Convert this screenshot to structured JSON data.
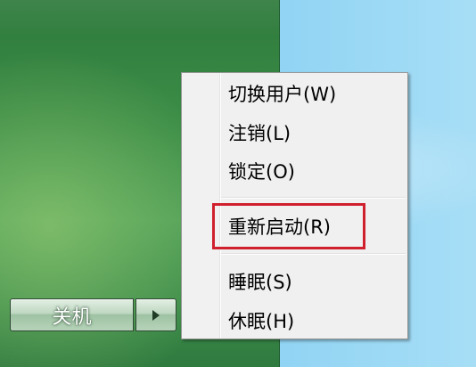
{
  "start_menu": {
    "shutdown_label": "关机",
    "arrow_icon": "triangle-right-icon"
  },
  "context_menu": {
    "items": [
      {
        "label": "切换用户(W)"
      },
      {
        "label": "注销(L)"
      },
      {
        "label": "锁定(O)"
      },
      {
        "label": "重新启动(R)"
      },
      {
        "label": "睡眠(S)"
      },
      {
        "label": "休眠(H)"
      }
    ]
  },
  "annotation": {
    "highlight_color": "#d0202e",
    "highlighted_item": "重新启动(R)"
  }
}
